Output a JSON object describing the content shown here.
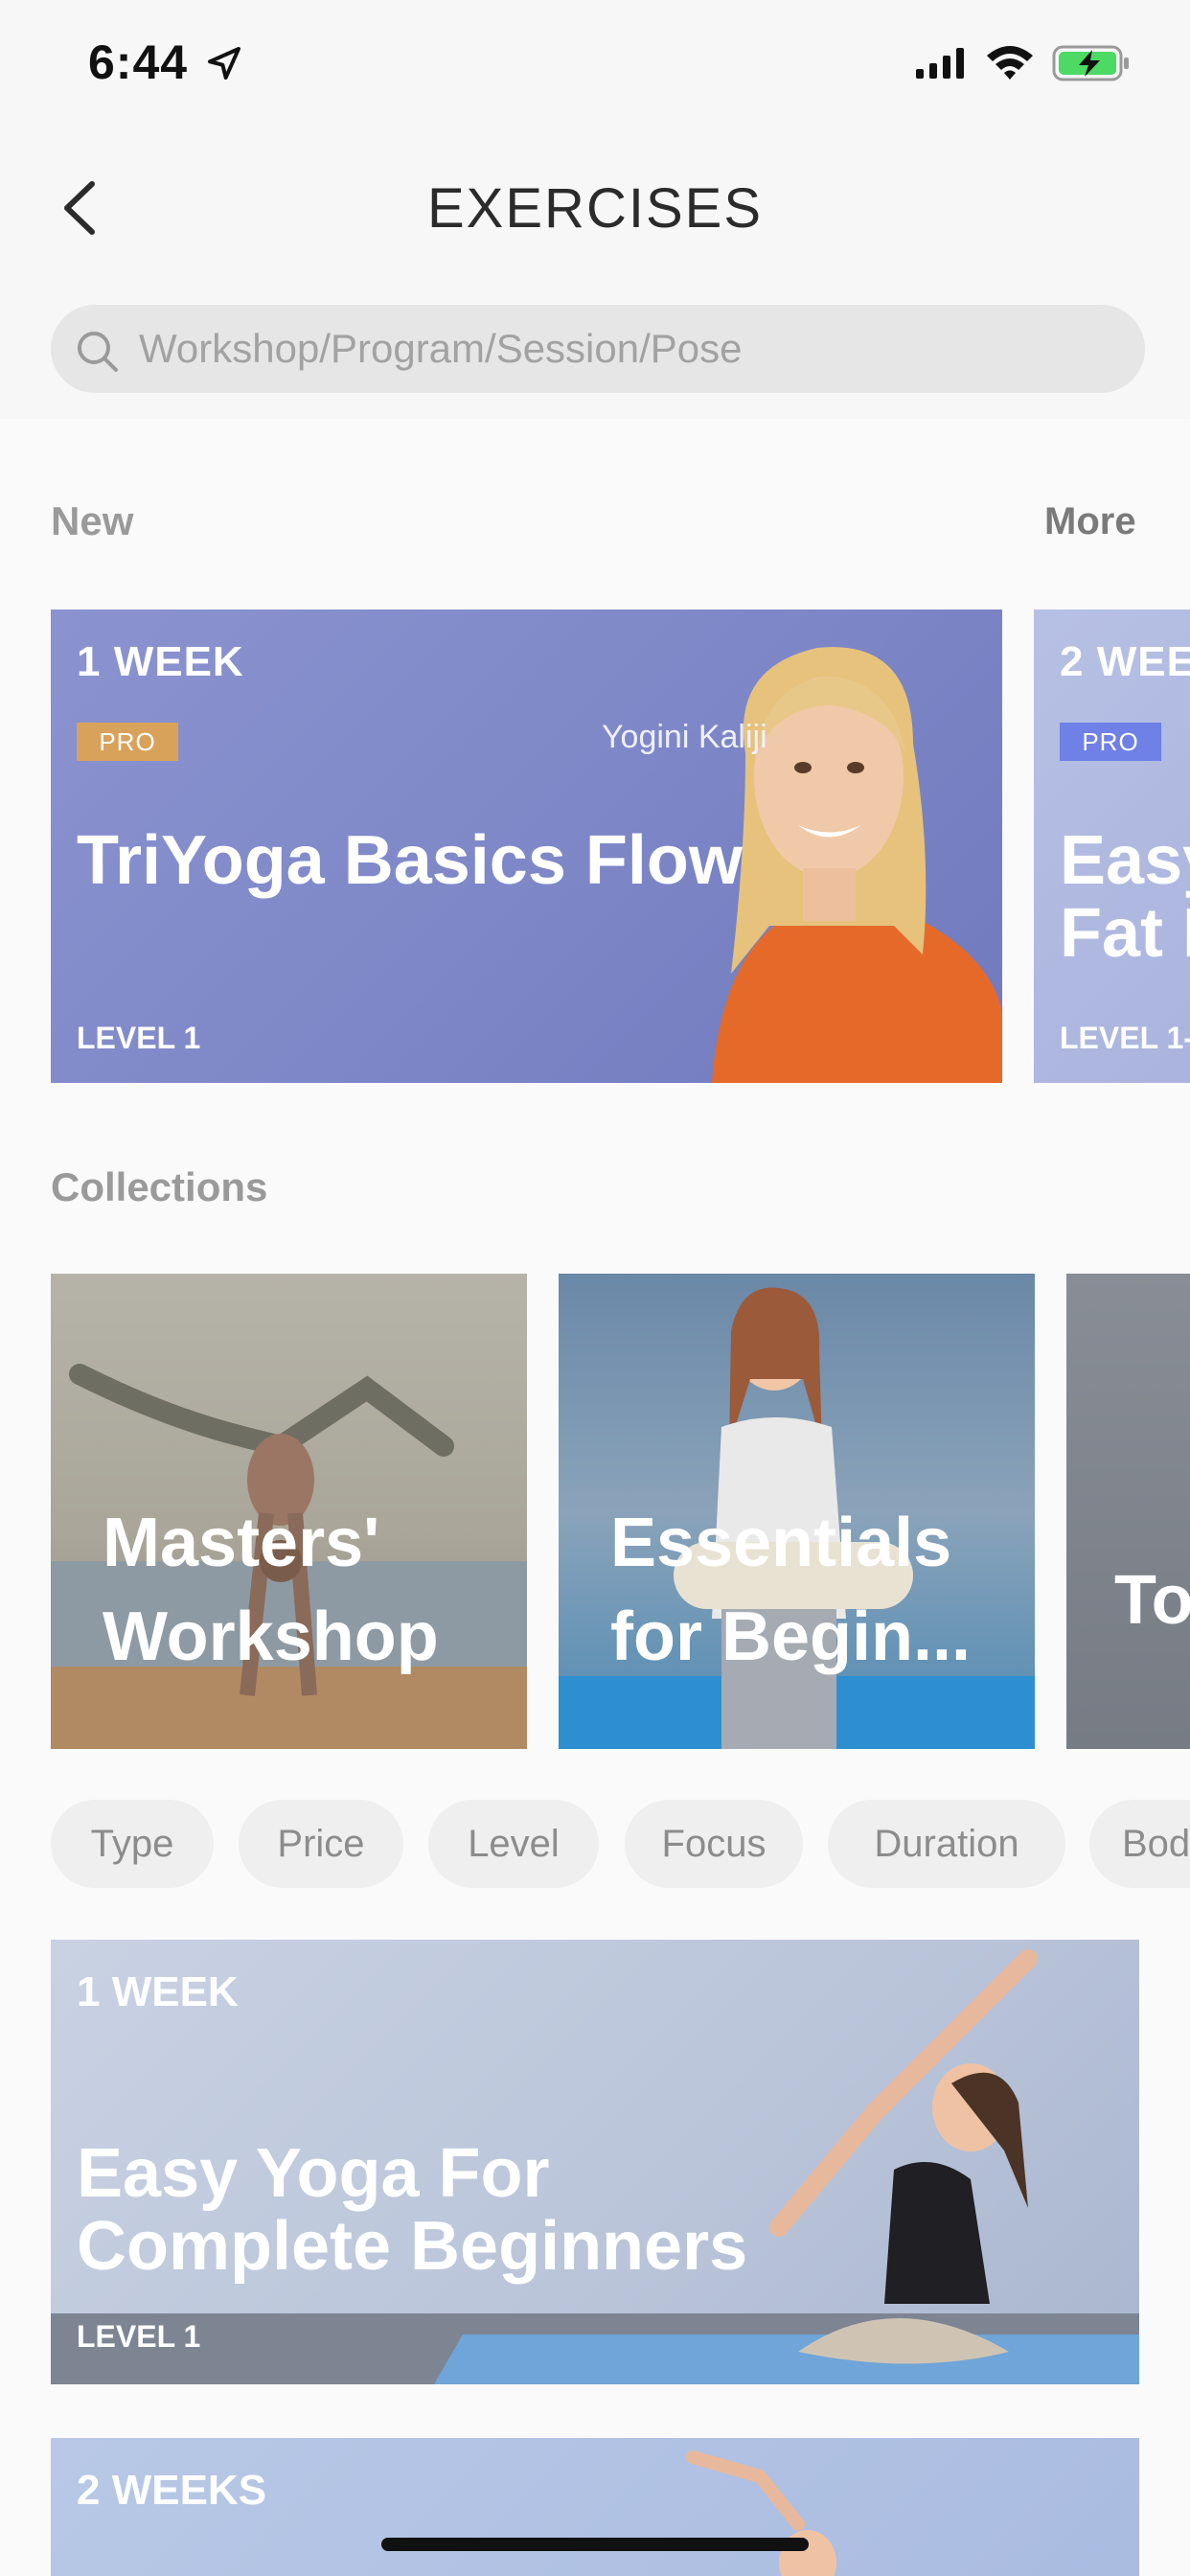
{
  "status_bar": {
    "time": "6:44"
  },
  "header": {
    "title": "EXERCISES",
    "search_placeholder": "Workshop/Program/Session/Pose"
  },
  "new_section": {
    "title": "New",
    "more_label": "More",
    "cards": [
      {
        "duration": "1 WEEK",
        "badge": "PRO",
        "instructor": "Yogini Kaliji",
        "title": "TriYoga Basics Flow",
        "level": "LEVEL 1"
      },
      {
        "duration": "2 WEE",
        "badge": "PRO",
        "title": "Easy\nFat I",
        "level": "LEVEL 1-"
      }
    ]
  },
  "collections_section": {
    "title": "Collections",
    "items": [
      {
        "title": "Masters'\nWorkshop"
      },
      {
        "title": "Essentials\nfor Begin..."
      },
      {
        "title": "To"
      }
    ]
  },
  "filters": [
    "Type",
    "Price",
    "Level",
    "Focus",
    "Duration",
    "Bod"
  ],
  "programs": [
    {
      "duration": "1 WEEK",
      "title": "Easy Yoga For\nComplete Beginners",
      "level": "LEVEL 1"
    },
    {
      "duration": "2 WEEKS"
    }
  ]
}
